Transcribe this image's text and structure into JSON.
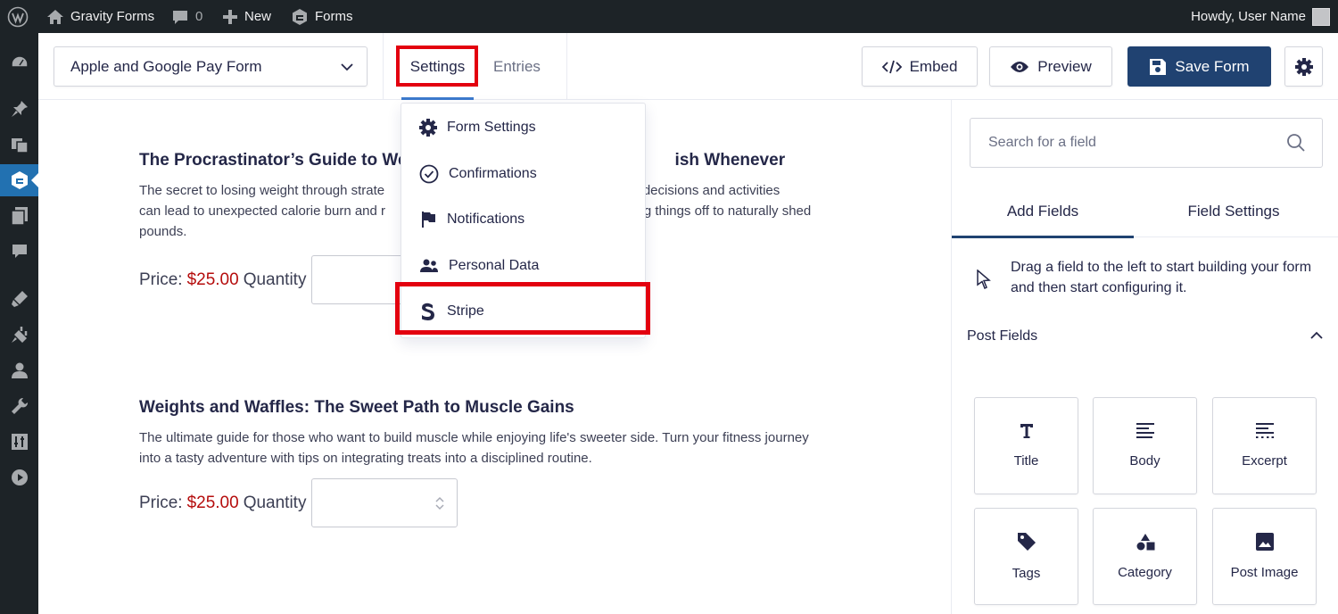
{
  "admin_bar": {
    "site_name": "Gravity Forms",
    "comments_count": "0",
    "new_label": "New",
    "forms_label": "Forms",
    "howdy": "Howdy, User Name"
  },
  "header": {
    "form_select_value": "Apple and Google Pay Form",
    "tabs": {
      "settings": "Settings",
      "entries": "Entries"
    },
    "embed_label": "Embed",
    "preview_label": "Preview",
    "save_label": "Save Form"
  },
  "settings_menu": {
    "items": [
      {
        "label": "Form Settings",
        "icon": "gear-icon"
      },
      {
        "label": "Confirmations",
        "icon": "check-circle-icon"
      },
      {
        "label": "Notifications",
        "icon": "flag-icon"
      },
      {
        "label": "Personal Data",
        "icon": "people-icon"
      },
      {
        "label": "Stripe",
        "icon": "stripe-icon"
      }
    ]
  },
  "canvas": {
    "products": [
      {
        "title": "The Procrastinator’s Guide to We",
        "title_end": "ish Whenever",
        "desc_line1_start": "The secret to losing weight through strate",
        "desc_line1_end": "ying decisions and activities",
        "desc_line2_start": "can lead to unexpected calorie burn and r",
        "desc_line2_end": "ting things off to naturally shed",
        "desc_line3": "pounds.",
        "price_label": "Price:",
        "price": "$25.00",
        "quantity_label": "Quantity"
      },
      {
        "title": "Weights and Waffles: The Sweet Path to Muscle Gains",
        "desc": "The ultimate guide for those who want to build muscle while enjoying life's sweeter side. Turn your fitness journey into a tasty adventure with tips on integrating treats into a disciplined routine.",
        "price_label": "Price:",
        "price": "$25.00",
        "quantity_label": "Quantity"
      }
    ]
  },
  "sidebar": {
    "search_placeholder": "Search for a field",
    "tabs": {
      "add_fields": "Add Fields",
      "field_settings": "Field Settings"
    },
    "hint": "Drag a field to the left to start building your form and then start configuring it.",
    "group_title": "Post Fields",
    "fields": [
      {
        "label": "Title",
        "icon": "title-icon"
      },
      {
        "label": "Body",
        "icon": "body-icon"
      },
      {
        "label": "Excerpt",
        "icon": "excerpt-icon"
      },
      {
        "label": "Tags",
        "icon": "tag-icon"
      },
      {
        "label": "Category",
        "icon": "category-icon"
      },
      {
        "label": "Post Image",
        "icon": "image-icon"
      }
    ]
  },
  "colors": {
    "admin_dark": "#1d2327",
    "save_button": "#204271",
    "highlight_red": "#e3000f",
    "price_red": "#b50d0d",
    "tab_underline": "#3c7acd"
  }
}
